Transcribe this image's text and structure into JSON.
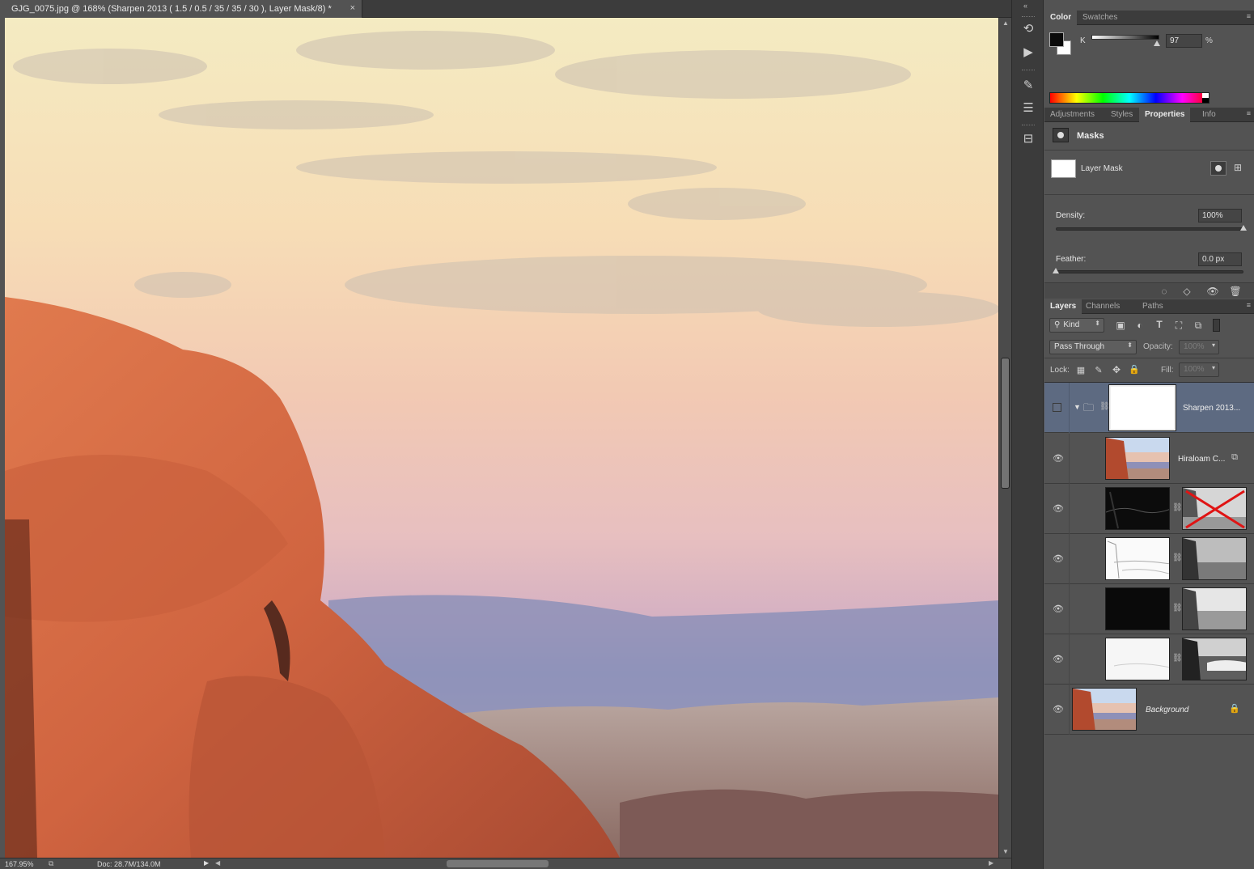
{
  "document": {
    "tab_title": "GJG_0075.jpg @ 168% (Sharpen 2013 ( 1.5 / 0.5 / 35 / 35 / 30 ), Layer Mask/8) *",
    "close_glyph": "×"
  },
  "status_bar": {
    "zoom": "167.95%",
    "doc_info": "Doc: 28.7M/134.0M"
  },
  "color_panel": {
    "tabs": [
      "Color",
      "Swatches"
    ],
    "active_tab": "Color",
    "channel_label": "K",
    "channel_value": "97",
    "unit": "%",
    "foreground_color": "#0a0a0a",
    "background_color": "#ffffff"
  },
  "properties_panel": {
    "tabs": [
      "Adjustments",
      "Styles",
      "Properties",
      "Info"
    ],
    "active_tab": "Properties",
    "section_title": "Masks",
    "mask_label": "Layer Mask",
    "density_label": "Density:",
    "density_value": "100%",
    "feather_label": "Feather:",
    "feather_value": "0.0 px",
    "density_fraction": 1.0,
    "feather_fraction": 0.0
  },
  "layers_panel": {
    "tabs": [
      "Layers",
      "Channels",
      "Paths"
    ],
    "active_tab": "Layers",
    "filter_kind": "Kind",
    "blend_mode": "Pass Through",
    "opacity_label": "Opacity:",
    "opacity_value": "100%",
    "lock_label": "Lock:",
    "fill_label": "Fill:",
    "fill_value": "100%",
    "layers": [
      {
        "name": "Sharpen 2013...",
        "type": "group",
        "selected": true
      },
      {
        "name": "Hiraloam C...",
        "type": "smart-object"
      },
      {
        "name": "",
        "type": "masked"
      },
      {
        "name": "",
        "type": "masked"
      },
      {
        "name": "",
        "type": "masked"
      },
      {
        "name": "",
        "type": "masked"
      },
      {
        "name": "Background",
        "type": "background",
        "locked": true
      }
    ]
  },
  "icons": {
    "eye": "eye-icon",
    "lock": "lock-icon",
    "chain": "chain-link-icon",
    "folder": "folder-icon"
  }
}
